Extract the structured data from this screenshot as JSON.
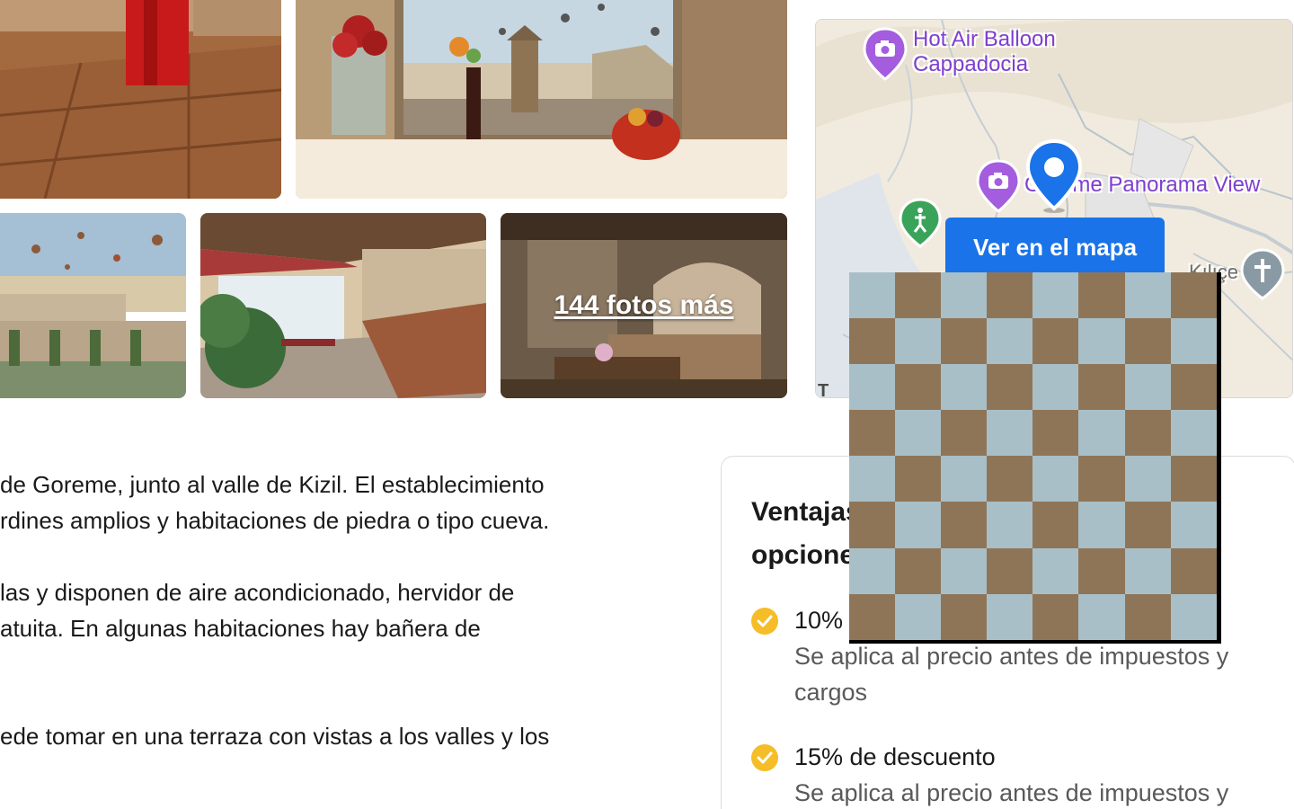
{
  "gallery": {
    "more_photos_label": "144 fotos más"
  },
  "map": {
    "pois": [
      {
        "name": "Hot Air Balloon\nCappadocia"
      },
      {
        "name": "Göreme Panorama View"
      }
    ],
    "visible_fragments": {
      "panorama_label": "Göreme Panorama View",
      "church_label": "Kılıçe",
      "attribution": "T"
    },
    "view_button_label": "Ver en el mapa",
    "colors": {
      "pin": "#1a73e8",
      "poi_photo": "#a45dde",
      "poi_park": "#3aa35a",
      "poi_church": "#8a9aa4",
      "button": "#1a73e8"
    }
  },
  "description": {
    "lines": [
      "de Goreme, junto al valle de Kizil. El establecimiento",
      "rdines amplios y habitaciones de piedra o tipo cueva.",
      "las y disponen de aire acondicionado, hervidor de",
      "atuita. En algunas habitaciones hay bañera de",
      "ede tomar en una terraza con vistas a los valles y los"
    ]
  },
  "benefits_card": {
    "title_line1": "Ventajas",
    "title_line2": "opciones",
    "items": [
      {
        "title": "10%",
        "detail": "Se aplica al precio antes de impuestos y cargos"
      },
      {
        "title": "15% de descuento",
        "detail": "Se aplica al precio antes de impuestos y"
      }
    ],
    "colors": {
      "check": "#f5bd27"
    }
  },
  "overlay": {
    "colors": {
      "light": "#a9bfc7",
      "dark": "#8f7558",
      "shadow": "#000000"
    }
  }
}
